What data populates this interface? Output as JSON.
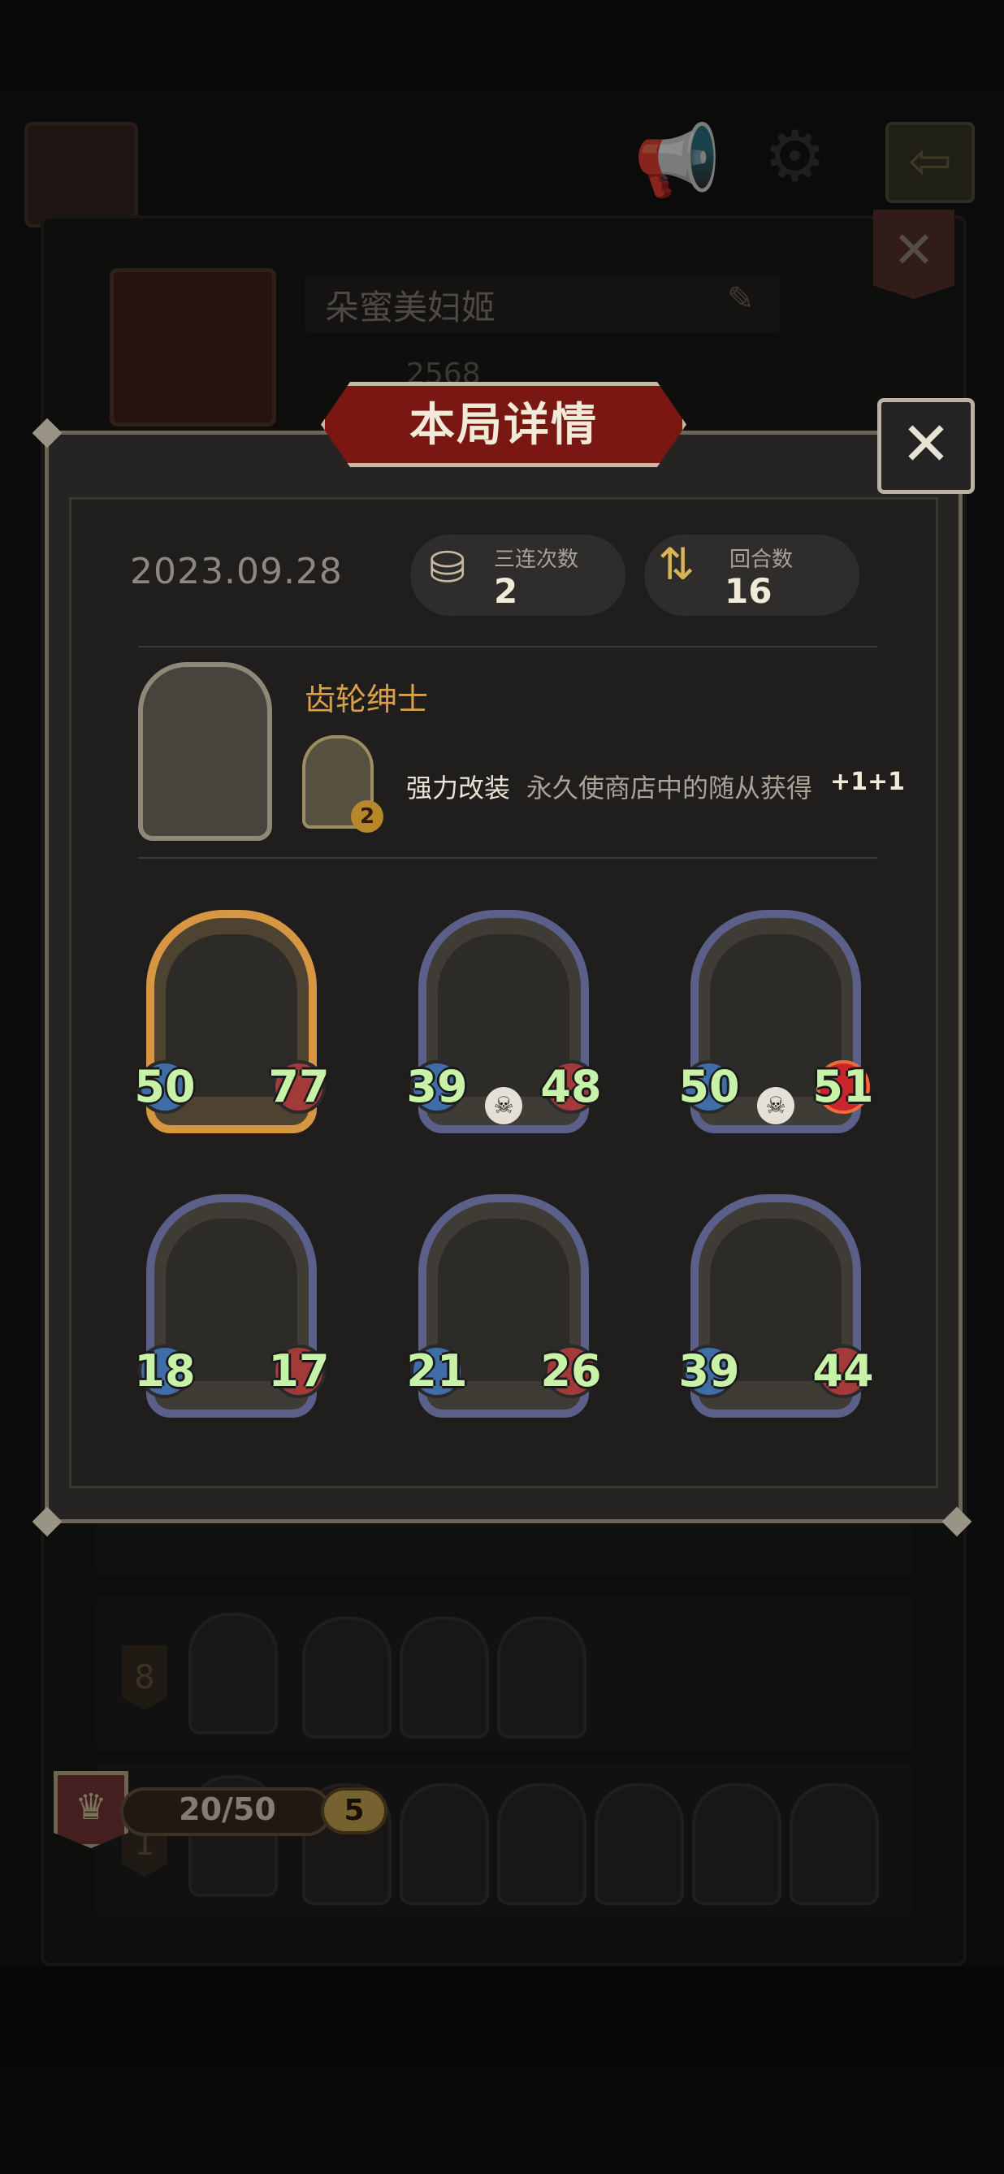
{
  "background": {
    "player_name": "朵蜜美妇姬",
    "score_partial": "2568",
    "rows": [
      {
        "rank": "8"
      },
      {
        "rank": "1"
      }
    ],
    "xp": "20/50",
    "level": "5"
  },
  "modal": {
    "title": "本局详情",
    "date": "2023.09.28",
    "stats": [
      {
        "label": "三连次数",
        "value": "2",
        "icon": "triple-icon"
      },
      {
        "label": "回合数",
        "value": "16",
        "icon": "rounds-icon"
      }
    ],
    "hero": {
      "name": "齿轮绅士",
      "skill_level": "2",
      "skill_name": "强力改装",
      "skill_desc": "永久使商店中的随从获得",
      "skill_bonus": "+1+1"
    },
    "minions": [
      {
        "atk": "50",
        "hp": "77",
        "frame": "gold",
        "skull": false,
        "hp_buff": false
      },
      {
        "atk": "39",
        "hp": "48",
        "frame": "blue",
        "skull": true,
        "hp_buff": false
      },
      {
        "atk": "50",
        "hp": "51",
        "frame": "blue",
        "skull": true,
        "hp_buff": true
      },
      {
        "atk": "18",
        "hp": "17",
        "frame": "blue",
        "skull": false,
        "hp_buff": false
      },
      {
        "atk": "21",
        "hp": "26",
        "frame": "blue",
        "skull": false,
        "hp_buff": false
      },
      {
        "atk": "39",
        "hp": "44",
        "frame": "blue",
        "skull": false,
        "hp_buff": false
      }
    ]
  },
  "colors": {
    "title_red": "#7a1712",
    "hero_name": "#d9a04a",
    "stat_green": "#c8f2a8",
    "gold_frame": "#d69642",
    "blue_frame": "#5a608a"
  }
}
